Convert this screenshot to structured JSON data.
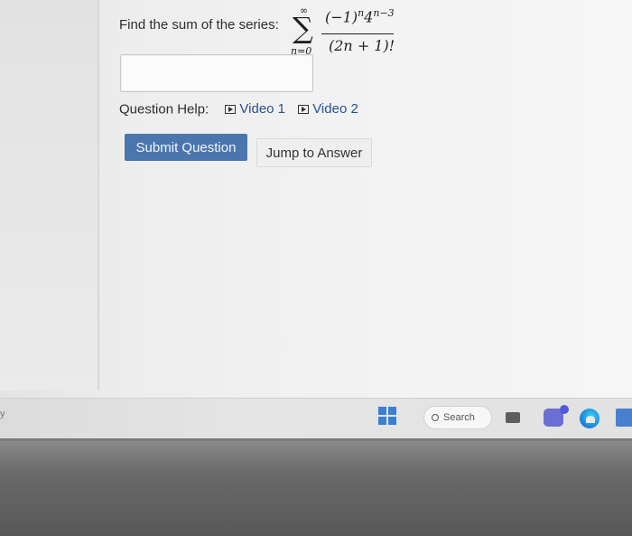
{
  "question": {
    "prompt": "Find the sum of the series:",
    "series": {
      "upper_limit": "∞",
      "lower_limit": "n=0",
      "numerator": "(−1)",
      "numerator_exp_n": "n",
      "numerator_base": "4",
      "numerator_exp": "n−3",
      "denominator": "(2n + 1)!"
    },
    "answer_value": ""
  },
  "help": {
    "label": "Question Help:",
    "video1": "Video 1",
    "video2": "Video 2"
  },
  "buttons": {
    "submit": "Submit Question",
    "jump": "Jump to Answer"
  },
  "taskbar": {
    "left_edge_char": "y",
    "search_label": "Search",
    "icons": [
      "windows-start-icon",
      "search-icon",
      "widgets-icon",
      "teams-icon",
      "edge-browser-icon",
      "store-icon"
    ]
  },
  "colors": {
    "submit_bg": "#4a76ad",
    "windows_blue": "#3a7fd1"
  }
}
